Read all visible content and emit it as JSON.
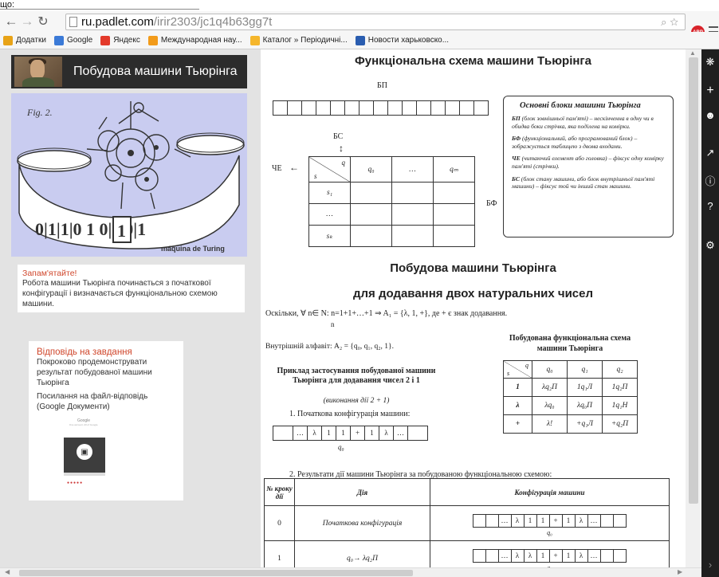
{
  "top_fragment": "що:",
  "browser": {
    "url_host": "ru.padlet.com",
    "url_path": "/irir2303/jc1q4b63gg7t",
    "abp_label": "ABP",
    "bookmarks": [
      {
        "label": "Додатки",
        "icon": "apps-grid-icon",
        "color": "#e8a317"
      },
      {
        "label": "Google",
        "icon": "google-icon",
        "color": "#3b7ad7"
      },
      {
        "label": "Яндекс",
        "icon": "yandex-icon",
        "color": "#e33a2b"
      },
      {
        "label": "Международная нау...",
        "icon": "globe-icon",
        "color": "#f29b1a"
      },
      {
        "label": "Каталог » Періодичні...",
        "icon": "folder-icon",
        "color": "#f5b62c"
      },
      {
        "label": "Новости харьковско...",
        "icon": "news-icon",
        "color": "#2a5db0"
      }
    ]
  },
  "padlet": {
    "title": "Побудова машини Тьюрінга",
    "machine_labels": {
      "fig": "Fig. 2.",
      "caption": "máquina de Turing",
      "tape": "0|1|1|0 1 0|1|0|1"
    },
    "note": {
      "title": "Запам'ятайте!",
      "body": "Робота машини Тьюрінга починається з початкової конфігурації і визначається функціональною схемою машини."
    },
    "answer": {
      "title": "Відповідь на завдання",
      "body": "Покроково продемонструвати результат побудованої машини Тьюрінга",
      "link": "Посилання на файл-відповідь (Google Документи)",
      "thumb_brand": "Google",
      "thumb_sub": "One account. All of Google."
    }
  },
  "scheme": {
    "title": "Функціональна схема машини Тьюрінга",
    "bp": "БП",
    "bs": "БС",
    "che": "ЧЕ",
    "bf": "БФ",
    "table": {
      "head": [
        "q₀",
        "…",
        "qₘ"
      ],
      "corner_top": "q",
      "corner_bottom": "s",
      "rows": [
        "s₁",
        "…",
        "sₖ"
      ]
    },
    "blocks_box": {
      "title": "Основні блоки машини Тьюрінга",
      "items": [
        {
          "term": "БП",
          "text": "(блок зовнішньої пам'яті) – нескінченна в одну чи в обидва боки стрічка, яка поділена на комірки."
        },
        {
          "term": "БФ",
          "text": "(функціональний, або програмований блок) – зображується таблицею з двома входами."
        },
        {
          "term": "ЧЕ",
          "text": "(читаючий елемент або головка) – фіксує одну комірку пам'яті (стрічки)."
        },
        {
          "term": "БС",
          "text": "(блок стану машини, або блок внутрішньої пам'яті машини) – фіксує той чи інший стан машини."
        }
      ]
    },
    "subtitle1": "Побудова машини Тьюрінга",
    "subtitle2": "для додавання двох натуральних чисел",
    "formula": "Оскільки, ∀ n∈ N: n=1+1+…+1 ⇒ A₁ = {λ, 1, +}, де + є знак додавання.",
    "formula_n": "n",
    "internal": "Внутрішній алфавіт: A₂ = {q₀, q₁, q₂, 1}.",
    "built_title": "Побудована функціональна схема машини Тьюрінга",
    "built_table": {
      "corner_top": "q",
      "corner_bottom": "s",
      "head": [
        "q₀",
        "q₁",
        "q₂"
      ],
      "rows": [
        {
          "s": "1",
          "cells": [
            "λq₂П",
            "1q₁Л",
            "1q₂П"
          ]
        },
        {
          "s": "λ",
          "cells": [
            "λq₀",
            "λq₀П",
            "1q₁Н"
          ]
        },
        {
          "s": "+",
          "cells": [
            "λ!",
            "+q₁Л",
            "+q₂П"
          ]
        }
      ]
    },
    "example_title": "Приклад застосування побудованої машини Тьюрінга для додавання чисел 2 і 1",
    "example_sub": "(виконання дії 2 + 1)",
    "step1": "1.  Початкова конфігурація машини:",
    "tape1": [
      "",
      "…",
      "λ",
      "1",
      "1",
      "+",
      "1",
      "λ",
      "…",
      ""
    ],
    "head_label": "q₀",
    "step2": "2.  Результати дії машини Тьюрінга за побудованою функціональною схемою:",
    "results": {
      "headers": [
        "№ кроку дії",
        "Дія",
        "Конфігурація машини"
      ],
      "rows": [
        {
          "n": "0",
          "action": "Початкова конфігурація",
          "tape": [
            "",
            "",
            "…",
            "λ",
            "1",
            "1",
            "+",
            "1",
            "λ",
            "…",
            "",
            ""
          ],
          "state": "q₀"
        },
        {
          "n": "1",
          "action": "q₀→ λq₂П",
          "tape": [
            "",
            "",
            "…",
            "λ",
            "λ",
            "1",
            "+",
            "1",
            "λ",
            "…",
            "",
            ""
          ],
          "state": "q₂"
        }
      ]
    }
  }
}
